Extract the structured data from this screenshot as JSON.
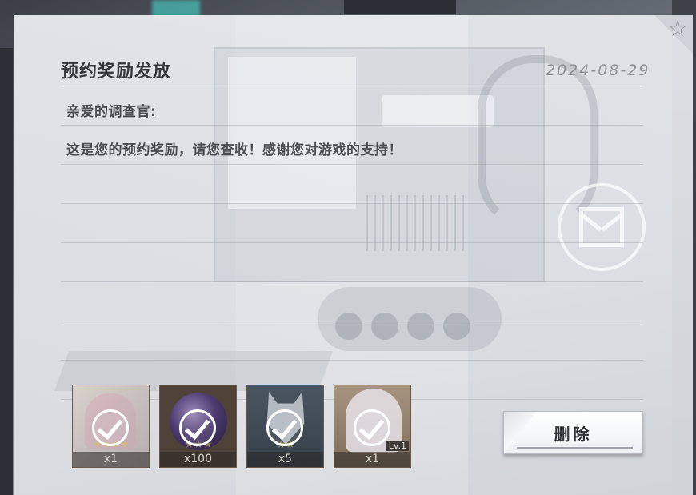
{
  "mail": {
    "title": "预约奖励发放",
    "date": "2024-08-29",
    "greeting": "亲爱的调查官:",
    "body": "这是您的预约奖励，请您查收！感谢您对游戏的支持！"
  },
  "rewards": [
    {
      "qty": "x1",
      "claimed": true,
      "icon": "portrait-item-icon"
    },
    {
      "qty": "x100",
      "claimed": true,
      "icon": "purple-orb-icon"
    },
    {
      "qty": "x5",
      "claimed": true,
      "icon": "cat-mask-icon"
    },
    {
      "qty": "x1",
      "claimed": true,
      "icon": "character-portrait-icon",
      "level": "Lv.1"
    }
  ],
  "actions": {
    "delete_label": "删除",
    "favorite_icon": "star-icon"
  }
}
